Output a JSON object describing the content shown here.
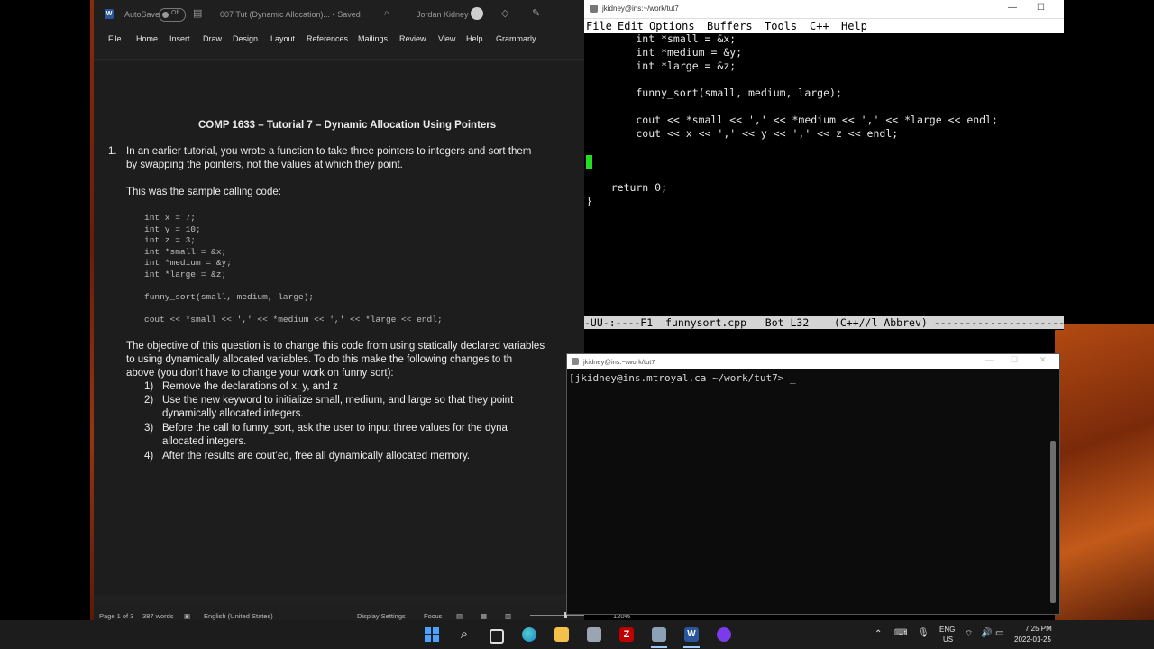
{
  "word": {
    "autosave_label": "AutoSave",
    "autosave_state": "Off",
    "doc_title": "007 Tut (Dynamic Allocation)... • Saved",
    "user_name": "Jordan Kidney",
    "menu": [
      "File",
      "Home",
      "Insert",
      "Draw",
      "Design",
      "Layout",
      "References",
      "Mailings",
      "Review",
      "View",
      "Help",
      "Grammarly"
    ],
    "doc_heading": "COMP 1633 – Tutorial 7 – Dynamic Allocation Using Pointers",
    "q_number": "1.",
    "q_line1": "In an earlier tutorial, you wrote a function to take three pointers to integers and sort them",
    "q_line2_a": "by swapping the pointers, ",
    "q_line2_not": "not",
    "q_line2_b": " the values at which they point.",
    "sample_intro": "This was the sample calling code:",
    "code": [
      "int x = 7;",
      "int y = 10;",
      "int z = 3;",
      "int *small = &x;",
      "int *medium = &y;",
      "int *large = &z;",
      "",
      "funny_sort(small, medium, large);",
      "",
      "cout << *small << ',' << *medium << ',' << *large << endl;"
    ],
    "objective_lines": [
      "The objective of this question is to change this code from using statically declared variables",
      "to using dynamically allocated variables. To do this make the following changes to th",
      "above (you don’t have to change your work on funny sort):"
    ],
    "steps": [
      {
        "num": "1)",
        "lines": [
          "Remove the declarations of x, y, and z"
        ]
      },
      {
        "num": "2)",
        "lines": [
          "Use the new keyword to initialize small, medium, and large so that they point",
          "dynamically allocated integers."
        ]
      },
      {
        "num": "3)",
        "lines": [
          "Before the call to funny_sort, ask the user to input three values for the dyna",
          "allocated integers."
        ]
      },
      {
        "num": "4)",
        "lines": [
          "After the results are cout’ed, free all dynamically allocated memory."
        ]
      }
    ],
    "status": {
      "page": "Page 1 of 3",
      "words": "387 words",
      "language": "English (United States)",
      "display_settings": "Display Settings",
      "focus": "Focus",
      "zoom": "120%"
    }
  },
  "emacs": {
    "title": "jkidney@ins:~/work/tut7",
    "menu": [
      "File",
      "Edit",
      "Options",
      "Buffers",
      "Tools",
      "C++",
      "Help"
    ],
    "lines": [
      "        int *small = &x;",
      "        int *medium = &y;",
      "        int *large = &z;",
      "",
      "        funny_sort(small, medium, large);",
      "",
      "        cout << *small << ',' << *medium << ',' << *large << endl;",
      "        cout << x << ',' << y << ',' << z << endl;",
      "",
      "",
      "",
      "    return 0;",
      "}"
    ],
    "modeline": "-UU-:----F1  funnysort.cpp   Bot L32    (C++//l Abbrev) ----------------------"
  },
  "terminal": {
    "title": "jkidney@ins:~/work/tut7",
    "prompt": "[jkidney@ins.mtroyal.ca ~/work/tut7> _"
  },
  "taskbar": {
    "lang_top": "ENG",
    "lang_bottom": "US",
    "time": "7:25 PM",
    "date": "2022-01-25"
  },
  "colors": {
    "word_blue": "#2b579a",
    "cursor_green": "#22dd22",
    "filezilla_red": "#bf0000"
  }
}
